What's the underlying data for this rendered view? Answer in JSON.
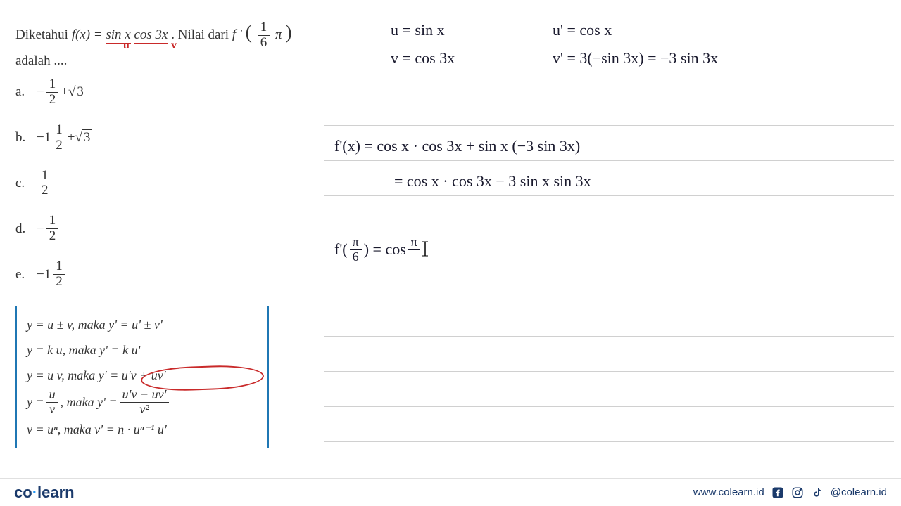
{
  "problem": {
    "prefix": "Diketahui ",
    "fx_label": "f(x) = ",
    "fx_expr_a": "sin x",
    "fx_expr_b": " cos 3x",
    "middle": ". Nilai dari ",
    "fprime_label": "f '",
    "arg_num": "1",
    "arg_den": "6",
    "arg_pi": "π",
    "suffix": "adalah ...."
  },
  "annotations": {
    "u_label_1": "u",
    "v_label_1": "v"
  },
  "options": {
    "a_label": "a.",
    "a_prefix": "−",
    "a_num": "1",
    "a_den": "2",
    "a_plus": " + ",
    "a_sqrt": "3",
    "b_label": "b.",
    "b_prefix": "−1",
    "b_num": "1",
    "b_den": "2",
    "b_plus": " + ",
    "b_sqrt": "3",
    "c_label": "c.",
    "c_num": "1",
    "c_den": "2",
    "d_label": "d.",
    "d_prefix": "−",
    "d_num": "1",
    "d_den": "2",
    "e_label": "e.",
    "e_prefix": "−1",
    "e_num": "1",
    "e_den": "2"
  },
  "rules": {
    "r1": "y = u ± v,  maka  y' = u' ± v'",
    "r2": "y = k u,  maka  y' = k u'",
    "r3a": "y = u v,  maka ",
    "r3b": "y' = u'v + uv'",
    "r4_left": "y = ",
    "r4_frac_num": "u",
    "r4_frac_den": "v",
    "r4_mid": ",  maka  y' = ",
    "r4_rfrac_num": "u'v − uv'",
    "r4_rfrac_den": "v²",
    "r5": "v = uⁿ,  maka  v' = n · uⁿ⁻¹ u'"
  },
  "handwriting": {
    "u_def": "u = sin x",
    "u_prime": "u' = cos x",
    "v_def": "v = cos 3x",
    "v_prime": "v' = 3(−sin 3x) = −3 sin 3x",
    "fp_line1": "f'(x) = cos x · cos 3x + sin x (−3 sin 3x)",
    "fp_line2": "= cos x · cos 3x − 3 sin x sin 3x",
    "fp_eval_left": "f'(",
    "fp_eval_num": "π",
    "fp_eval_den": "6",
    "fp_eval_mid": ") = cos ",
    "fp_eval_rnum": "π",
    "fp_eval_cursor": "_"
  },
  "footer": {
    "logo_co": "co",
    "logo_dot": "·",
    "logo_learn": "learn",
    "url": "www.colearn.id",
    "handle": "@colearn.id"
  }
}
